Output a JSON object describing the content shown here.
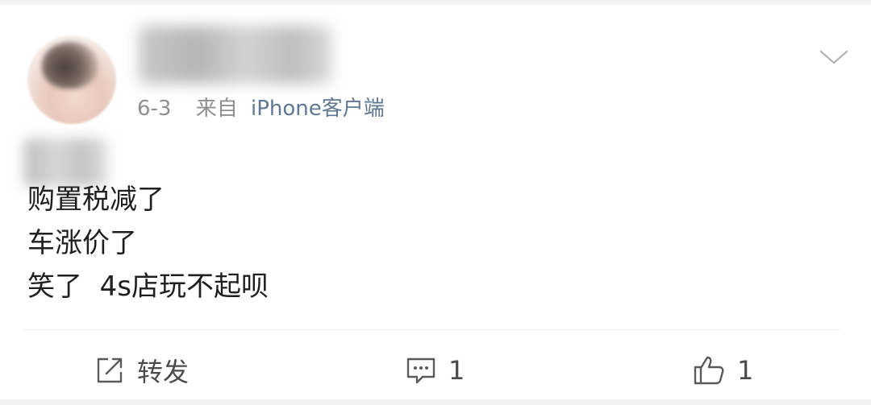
{
  "post": {
    "author": {
      "name": "",
      "avatar": "blurred-avatar"
    },
    "date": "6-3",
    "source_prefix": "来自",
    "source": "iPhone客户端",
    "content_lines": [
      "购置税减了",
      "车涨价了",
      "笑了  4s店玩不起呗"
    ]
  },
  "actions": {
    "repost": {
      "icon": "share-icon",
      "label": "转发"
    },
    "comment": {
      "icon": "comment-icon",
      "count": "1"
    },
    "like": {
      "icon": "thumbs-up-icon",
      "count": "1"
    }
  },
  "colors": {
    "meta_text": "#8f8f8f",
    "source_link": "#5f7894",
    "body_text": "#1f1f1f",
    "action_text": "#4b4b4b"
  }
}
